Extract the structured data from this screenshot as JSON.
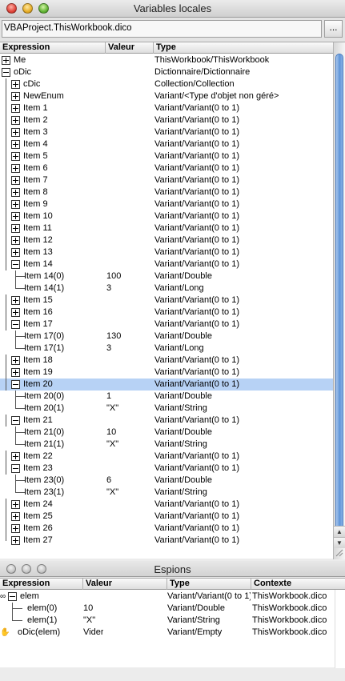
{
  "window1": {
    "title": "Variables locales"
  },
  "context": {
    "path": "VBAProject.ThisWorkbook.dico",
    "button": "..."
  },
  "locals": {
    "headers": [
      "Expression",
      "Valeur",
      "Type"
    ],
    "rows": [
      {
        "level": 0,
        "toggle": "plus",
        "expression": "Me",
        "value": "",
        "type": "ThisWorkbook/ThisWorkbook"
      },
      {
        "level": 0,
        "toggle": "minus",
        "expression": "oDic",
        "value": "",
        "type": "Dictionnaire/Dictionnaire"
      },
      {
        "level": 1,
        "toggle": "plus",
        "expression": "cDic",
        "value": "",
        "type": "Collection/Collection"
      },
      {
        "level": 1,
        "toggle": "plus",
        "expression": "NewEnum",
        "value": "",
        "type": "Variant/<Type d'objet non géré>"
      },
      {
        "level": 1,
        "toggle": "plus",
        "expression": "Item 1",
        "value": "",
        "type": "Variant/Variant(0 to 1)"
      },
      {
        "level": 1,
        "toggle": "plus",
        "expression": "Item 2",
        "value": "",
        "type": "Variant/Variant(0 to 1)"
      },
      {
        "level": 1,
        "toggle": "plus",
        "expression": "Item 3",
        "value": "",
        "type": "Variant/Variant(0 to 1)"
      },
      {
        "level": 1,
        "toggle": "plus",
        "expression": "Item 4",
        "value": "",
        "type": "Variant/Variant(0 to 1)"
      },
      {
        "level": 1,
        "toggle": "plus",
        "expression": "Item 5",
        "value": "",
        "type": "Variant/Variant(0 to 1)"
      },
      {
        "level": 1,
        "toggle": "plus",
        "expression": "Item 6",
        "value": "",
        "type": "Variant/Variant(0 to 1)"
      },
      {
        "level": 1,
        "toggle": "plus",
        "expression": "Item 7",
        "value": "",
        "type": "Variant/Variant(0 to 1)"
      },
      {
        "level": 1,
        "toggle": "plus",
        "expression": "Item 8",
        "value": "",
        "type": "Variant/Variant(0 to 1)"
      },
      {
        "level": 1,
        "toggle": "plus",
        "expression": "Item 9",
        "value": "",
        "type": "Variant/Variant(0 to 1)"
      },
      {
        "level": 1,
        "toggle": "plus",
        "expression": "Item 10",
        "value": "",
        "type": "Variant/Variant(0 to 1)"
      },
      {
        "level": 1,
        "toggle": "plus",
        "expression": "Item 11",
        "value": "",
        "type": "Variant/Variant(0 to 1)"
      },
      {
        "level": 1,
        "toggle": "plus",
        "expression": "Item 12",
        "value": "",
        "type": "Variant/Variant(0 to 1)"
      },
      {
        "level": 1,
        "toggle": "plus",
        "expression": "Item 13",
        "value": "",
        "type": "Variant/Variant(0 to 1)"
      },
      {
        "level": 1,
        "toggle": "minus",
        "expression": "Item 14",
        "value": "",
        "type": "Variant/Variant(0 to 1)"
      },
      {
        "level": 2,
        "toggle": "",
        "expression": "Item 14(0)",
        "value": "100",
        "type": "Variant/Double"
      },
      {
        "level": 2,
        "toggle": "",
        "expression": "Item 14(1)",
        "value": "3",
        "type": "Variant/Long"
      },
      {
        "level": 1,
        "toggle": "plus",
        "expression": "Item 15",
        "value": "",
        "type": "Variant/Variant(0 to 1)"
      },
      {
        "level": 1,
        "toggle": "plus",
        "expression": "Item 16",
        "value": "",
        "type": "Variant/Variant(0 to 1)"
      },
      {
        "level": 1,
        "toggle": "minus",
        "expression": "Item 17",
        "value": "",
        "type": "Variant/Variant(0 to 1)"
      },
      {
        "level": 2,
        "toggle": "",
        "expression": "Item 17(0)",
        "value": "130",
        "type": "Variant/Double"
      },
      {
        "level": 2,
        "toggle": "",
        "expression": "Item 17(1)",
        "value": "3",
        "type": "Variant/Long"
      },
      {
        "level": 1,
        "toggle": "plus",
        "expression": "Item 18",
        "value": "",
        "type": "Variant/Variant(0 to 1)"
      },
      {
        "level": 1,
        "toggle": "plus",
        "expression": "Item 19",
        "value": "",
        "type": "Variant/Variant(0 to 1)"
      },
      {
        "level": 1,
        "toggle": "minus",
        "expression": "Item 20",
        "value": "",
        "type": "Variant/Variant(0 to 1)",
        "selected": true
      },
      {
        "level": 2,
        "toggle": "",
        "expression": "Item 20(0)",
        "value": "1",
        "type": "Variant/Double"
      },
      {
        "level": 2,
        "toggle": "",
        "expression": "Item 20(1)",
        "value": "\"X\"",
        "type": "Variant/String"
      },
      {
        "level": 1,
        "toggle": "minus",
        "expression": "Item 21",
        "value": "",
        "type": "Variant/Variant(0 to 1)"
      },
      {
        "level": 2,
        "toggle": "",
        "expression": "Item 21(0)",
        "value": "10",
        "type": "Variant/Double"
      },
      {
        "level": 2,
        "toggle": "",
        "expression": "Item 21(1)",
        "value": "\"X\"",
        "type": "Variant/String"
      },
      {
        "level": 1,
        "toggle": "plus",
        "expression": "Item 22",
        "value": "",
        "type": "Variant/Variant(0 to 1)"
      },
      {
        "level": 1,
        "toggle": "minus",
        "expression": "Item 23",
        "value": "",
        "type": "Variant/Variant(0 to 1)"
      },
      {
        "level": 2,
        "toggle": "",
        "expression": "Item 23(0)",
        "value": "6",
        "type": "Variant/Double"
      },
      {
        "level": 2,
        "toggle": "",
        "expression": "Item 23(1)",
        "value": "\"X\"",
        "type": "Variant/String"
      },
      {
        "level": 1,
        "toggle": "plus",
        "expression": "Item 24",
        "value": "",
        "type": "Variant/Variant(0 to 1)"
      },
      {
        "level": 1,
        "toggle": "plus",
        "expression": "Item 25",
        "value": "",
        "type": "Variant/Variant(0 to 1)"
      },
      {
        "level": 1,
        "toggle": "plus",
        "expression": "Item 26",
        "value": "",
        "type": "Variant/Variant(0 to 1)"
      },
      {
        "level": 1,
        "toggle": "plus",
        "expression": "Item 27",
        "value": "",
        "type": "Variant/Variant(0 to 1)"
      }
    ]
  },
  "window2": {
    "title": "Espions"
  },
  "watches": {
    "headers": [
      "Expression",
      "Valeur",
      "Type",
      "Contexte"
    ],
    "rows": [
      {
        "level": 0,
        "toggle": "minus",
        "icon": "glasses-icon",
        "expression": "elem",
        "value": "",
        "type": "Variant/Variant(0 to 1)",
        "context": "ThisWorkbook.dico"
      },
      {
        "level": 1,
        "toggle": "",
        "expression": "elem(0)",
        "value": "10",
        "type": "Variant/Double",
        "context": "ThisWorkbook.dico"
      },
      {
        "level": 1,
        "toggle": "",
        "expression": "elem(1)",
        "value": "\"X\"",
        "type": "Variant/String",
        "context": "ThisWorkbook.dico"
      },
      {
        "level": 0,
        "toggle": "",
        "icon": "hand-icon",
        "expression": "oDic(elem)",
        "value": "Vider",
        "type": "Variant/Empty",
        "context": "ThisWorkbook.dico"
      }
    ]
  },
  "colors": {
    "selection": "#b7d2f5",
    "scroll_thumb": "#5f95d8"
  }
}
